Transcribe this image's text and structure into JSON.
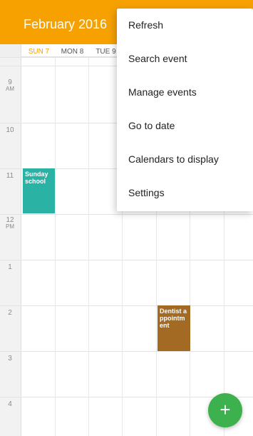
{
  "header": {
    "title": "February 2016",
    "color": "#f6a100"
  },
  "days": [
    {
      "label": "SUN 7",
      "highlight": true
    },
    {
      "label": "MON 8",
      "highlight": false
    },
    {
      "label": "TUE 9",
      "highlight": false
    }
  ],
  "hours": [
    {
      "num": "9",
      "ampm": "AM"
    },
    {
      "num": "10",
      "ampm": ""
    },
    {
      "num": "11",
      "ampm": ""
    },
    {
      "num": "12",
      "ampm": "PM"
    },
    {
      "num": "1",
      "ampm": ""
    },
    {
      "num": "2",
      "ampm": ""
    },
    {
      "num": "3",
      "ampm": ""
    },
    {
      "num": "4",
      "ampm": ""
    }
  ],
  "events": {
    "sunday_school": {
      "title": "Sunday school",
      "color": "#2ab3a5"
    },
    "dentist": {
      "title": "Dentist appointment",
      "color": "#a36a24"
    }
  },
  "menu": {
    "items": [
      {
        "label": "Refresh"
      },
      {
        "label": "Search event"
      },
      {
        "label": "Manage events"
      },
      {
        "label": "Go to date"
      },
      {
        "label": "Calendars to display"
      },
      {
        "label": "Settings"
      }
    ]
  },
  "fab": {
    "icon": "plus-icon",
    "glyph": "+",
    "color": "#3cb14d"
  }
}
